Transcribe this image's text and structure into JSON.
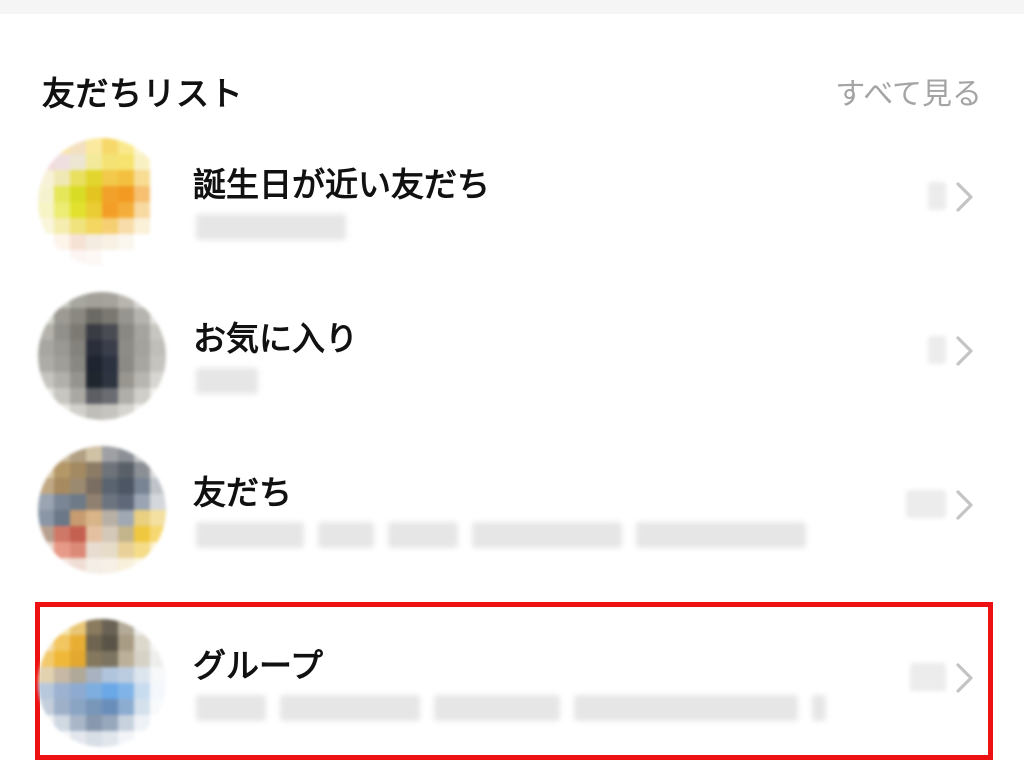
{
  "section": {
    "title": "友だちリスト",
    "see_all": "すべて見る"
  },
  "rows": [
    {
      "title": "誕生日が近い友だち",
      "chevron_icon": "chevron-right-icon"
    },
    {
      "title": "お気に入り",
      "chevron_icon": "chevron-right-icon"
    },
    {
      "title": "友だち",
      "chevron_icon": "chevron-right-icon"
    },
    {
      "title": "グループ",
      "chevron_icon": "chevron-right-icon"
    }
  ],
  "colors": {
    "highlight": "#ee1111",
    "muted_text": "#a4a4a4",
    "title_text": "#111111"
  }
}
